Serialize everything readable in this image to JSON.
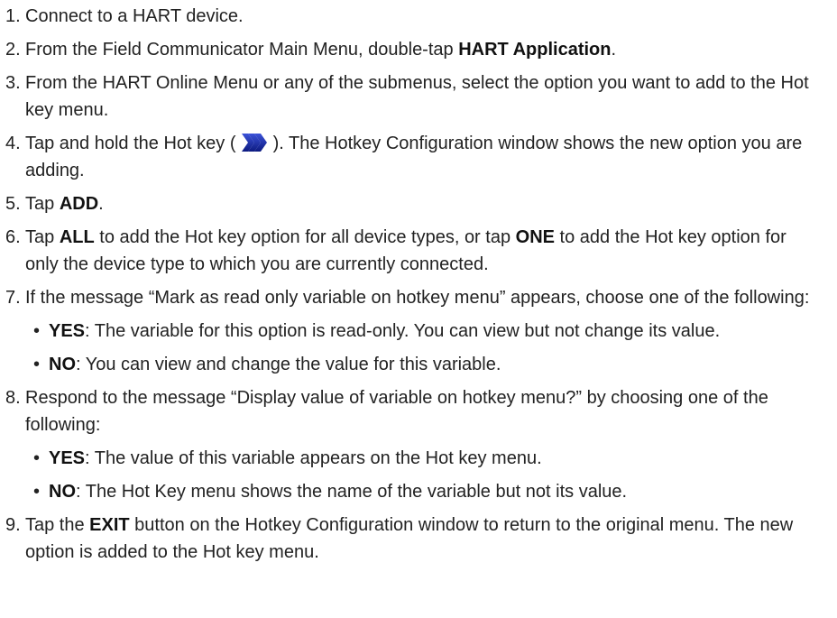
{
  "steps": [
    {
      "num": "1.",
      "text": "Connect to a HART device."
    },
    {
      "num": "2.",
      "pre": "From the Field Communicator Main Menu, double-tap ",
      "bold": "HART Application",
      "post": "."
    },
    {
      "num": "3.",
      "text": "From the HART Online Menu or any of the submenus, select the option you want to add to the Hot key menu."
    },
    {
      "num": "4.",
      "pre": "Tap and hold the Hot key ( ",
      "icon": "hot-key-chevrons-icon",
      "post": " ). The Hotkey Configuration window shows the new option you are adding."
    },
    {
      "num": "5.",
      "pre": "Tap ",
      "bold": "ADD",
      "post": "."
    },
    {
      "num": "6.",
      "pre": "Tap ",
      "bold": "ALL",
      "mid": " to add the Hot key option for all device types, or tap ",
      "bold2": "ONE",
      "post": " to add the Hot key option for only the device type to which you are currently connected."
    },
    {
      "num": "7.",
      "text": "If the message “Mark as read only variable on hotkey menu” appears, choose one of the following:",
      "sub": [
        {
          "bullet": "•",
          "bold": "YES",
          "text": ": The variable for this option is read-only. You can view but not change its value."
        },
        {
          "bullet": "•",
          "bold": "NO",
          "text": ": You can view and change the value for this variable."
        }
      ]
    },
    {
      "num": "8.",
      "text": "Respond to the message “Display value of variable on hotkey menu?” by choosing one of the following:",
      "sub": [
        {
          "bullet": "•",
          "bold": "YES",
          "text": ": The value of this variable appears on the Hot key menu."
        },
        {
          "bullet": "•",
          "bold": "NO",
          "text": ": The Hot Key menu shows the name of the variable but not its value."
        }
      ]
    },
    {
      "num": "9.",
      "pre": "Tap the ",
      "bold": "EXIT",
      "post": " button on the Hotkey Configuration window to return to the original menu. The new option is added to the Hot key menu."
    }
  ],
  "colors": {
    "text": "#222222",
    "icon_blue": "#1f2fb3",
    "icon_blue_dark": "#0c1a80"
  }
}
